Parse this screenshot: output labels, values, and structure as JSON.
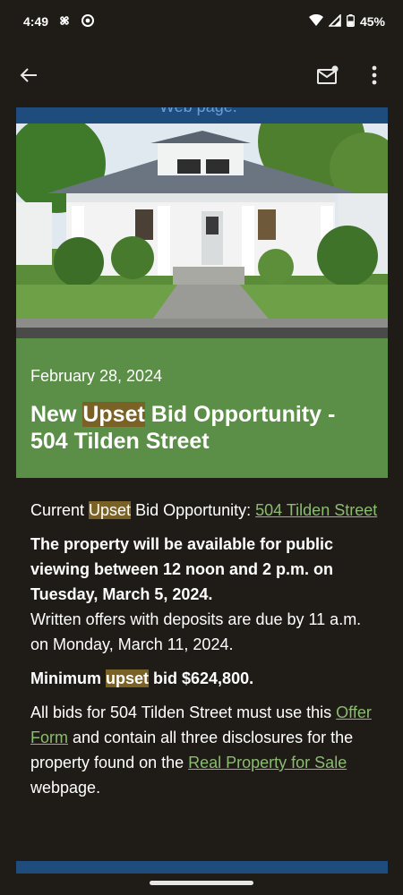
{
  "status_bar": {
    "time": "4:49",
    "battery": "45%"
  },
  "top_bar": {
    "back_icon": "arrow-back-icon",
    "mail_icon": "mark-unread-icon",
    "more_icon": "more-vert-icon"
  },
  "article": {
    "cut_link_text": "Web page.",
    "date": "February 28, 2024",
    "headline_pre": "New ",
    "headline_hl": "Upset",
    "headline_post": " Bid Opportunity - 504 Tilden Street",
    "current_pre": "Current ",
    "current_hl": "Upset",
    "current_post": " Bid Opportunity: ",
    "current_link": "504 Tilden Street",
    "viewing_bold": "The property will be available for public viewing between 12 noon and 2 p.m. on Tuesday, March 5, 2024.",
    "offers_text": "Written offers with deposits are due by 11 a.m. on Monday, March 11, 2024.",
    "min_pre": "Minimum ",
    "min_hl": "upset",
    "min_post": " bid $624,800.",
    "bids_pre": "All bids for 504 Tilden Street must use this ",
    "offer_form_link": "Offer Form",
    "bids_mid": " and contain all three disclosures for the property found on the ",
    "real_property_link": "Real Property for Sale",
    "bids_post": " webpage."
  },
  "colors": {
    "background": "#1f1b16",
    "header_green": "#5b8e47",
    "link_green": "#8bbc72",
    "highlight": "#7a6126",
    "strip_blue": "#1e4d7d"
  }
}
